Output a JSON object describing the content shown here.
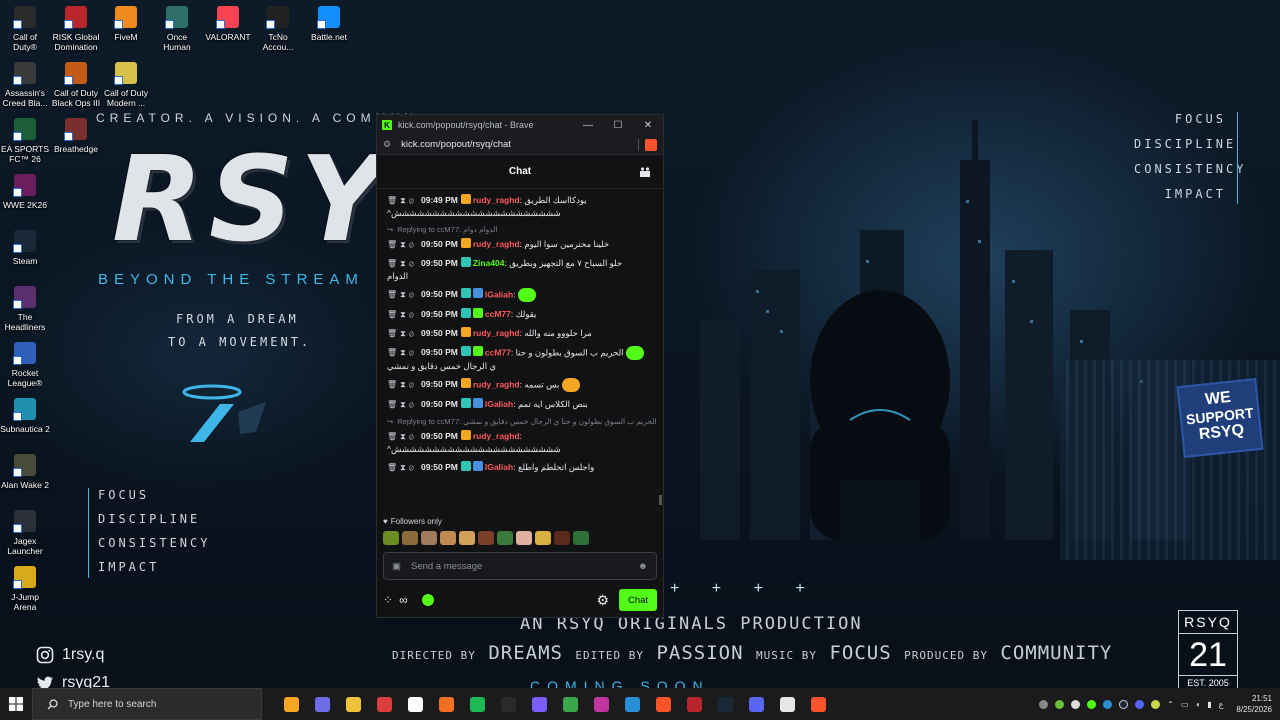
{
  "wallpaper": {
    "tagline": "CREATOR. A VISION. A COMMUN",
    "name": "RSYQ",
    "subtitle": "BEYOND THE STREAM",
    "dream_line1": "FROM A DREAM",
    "dream_line2": "TO A MOVEMENT.",
    "values": [
      "FOCUS",
      "DISCIPLINE",
      "CONSISTENCY",
      "IMPACT"
    ],
    "support_sign": [
      "WE",
      "SUPPORT",
      "RSYQ"
    ],
    "pluses": "+ + + +",
    "production": "AN RSYQ ORIGINALS PRODUCTION",
    "credits": [
      {
        "label": "DIRECTED BY",
        "value": "DREAMS"
      },
      {
        "label": "EDITED BY",
        "value": "PASSION"
      },
      {
        "label": "MUSIC BY",
        "value": "FOCUS"
      },
      {
        "label": "PRODUCED BY",
        "value": "COMMUNITY"
      }
    ],
    "coming_soon": "COMING SOON",
    "badge": {
      "top": "RSYQ",
      "number": "21",
      "est": "EST. 2005"
    },
    "instagram": "1rsy.q",
    "twitter": "rsyq21",
    "accent_color": "#3fb6e8"
  },
  "desktop_icons": [
    {
      "label": "Call of Duty®",
      "color": "#2b2b2b"
    },
    {
      "label": "RISK Global Domination",
      "color": "#b8262c"
    },
    {
      "label": "FiveM",
      "color": "#f08a1c"
    },
    {
      "label": "Once Human",
      "color": "#2f6f6a"
    },
    {
      "label": "VALORANT",
      "color": "#fa4454"
    },
    {
      "label": "TcNo Accou...",
      "color": "#222222"
    },
    {
      "label": "Battle.net",
      "color": "#148eff"
    },
    {
      "label": "Assassin's Creed Bla...",
      "color": "#3a3a3a"
    },
    {
      "label": "Call of Duty Black Ops III",
      "color": "#c25a18"
    },
    {
      "label": "Call of Duty Modern ...",
      "color": "#d8c14a"
    },
    {
      "label": "EA SPORTS FC™ 26",
      "color": "#1d5e3a"
    },
    {
      "label": "Breathedge",
      "color": "#7a2f2f"
    },
    {
      "label": "WWE 2K26",
      "color": "#6b1e5e"
    },
    {
      "label": "Steam",
      "color": "#1b2838"
    },
    {
      "label": "The Headliners",
      "color": "#5a2f6e"
    },
    {
      "label": "Rocket League®",
      "color": "#2f5fb8"
    },
    {
      "label": "Subnautica 2",
      "color": "#1f8fb0"
    },
    {
      "label": "Alan Wake 2",
      "color": "#4a4a3a"
    },
    {
      "label": "Jagex Launcher",
      "color": "#2a2f3a"
    },
    {
      "label": "J-Jump Arena",
      "color": "#d8a91a"
    }
  ],
  "browser": {
    "window_title": "kick.com/popout/rsyq/chat - Brave",
    "url": "kick.com/popout/rsyq/chat",
    "minimize": "—",
    "maximize": "☐",
    "close": "✕"
  },
  "chat": {
    "header": "Chat",
    "messages": [
      {
        "reply": "",
        "time": "09:49 PM",
        "badges": [
          "#f5a623"
        ],
        "user": "rudy_raghd",
        "user_color": "#ff5a5a",
        "text": "يودكااسك الطريق",
        "cont": "^شششششششششششششششششششششش",
        "emote": ""
      },
      {
        "reply": "Replying to ccM77: الدوام دوام",
        "time": "09:50 PM",
        "badges": [
          "#f5a623"
        ],
        "user": "rudy_raghd",
        "user_color": "#ff5a5a",
        "text": "خلينا محترمين سوا اليوم",
        "cont": "",
        "emote": ""
      },
      {
        "reply": "",
        "time": "09:50 PM",
        "badges": [
          "#2ec4b6"
        ],
        "user": "Zina404",
        "user_color": "#53fc18",
        "text": "حلو السباح ٧ مع التجهيز وبطريق",
        "cont": "الدوام",
        "emote": ""
      },
      {
        "reply": "",
        "time": "09:50 PM",
        "badges": [
          "#2ec4b6",
          "#4a90e2"
        ],
        "user": "lGaliah",
        "user_color": "#ff5a5a",
        "text": "",
        "cont": "",
        "emote": "#53fc18"
      },
      {
        "reply": "",
        "time": "09:50 PM",
        "badges": [
          "#2ec4b6",
          "#53fc18"
        ],
        "user": "ccM77",
        "user_color": "#ff5a5a",
        "text": "يقولك",
        "cont": "",
        "emote": ""
      },
      {
        "reply": "",
        "time": "09:50 PM",
        "badges": [
          "#f5a623"
        ],
        "user": "rudy_raghd",
        "user_color": "#ff5a5a",
        "text": "مرا حلووو منه والله",
        "cont": "",
        "emote": ""
      },
      {
        "reply": "",
        "time": "09:50 PM",
        "badges": [
          "#2ec4b6",
          "#53fc18"
        ],
        "user": "ccM77",
        "user_color": "#ff5a5a",
        "text": "الحريم ب السوق بطولون و حنا",
        "cont": "ي الرجال خمس دقايق و نمشي",
        "emote": "#53fc18"
      },
      {
        "reply": "",
        "time": "09:50 PM",
        "badges": [
          "#f5a623"
        ],
        "user": "rudy_raghd",
        "user_color": "#ff5a5a",
        "text": "بس تسمه",
        "cont": "",
        "emote": "#f5a623"
      },
      {
        "reply": "",
        "time": "09:50 PM",
        "badges": [
          "#2ec4b6",
          "#4a90e2"
        ],
        "user": "lGaliah",
        "user_color": "#ff5a5a",
        "text": "بنص الكلاس ايه تمم",
        "cont": "",
        "emote": ""
      },
      {
        "reply": "Replying to ccM77: الحريم ب السوق بطولون و حنا ي الرجال خمس دقايق و نمشي",
        "time": "09:50 PM",
        "badges": [
          "#f5a623"
        ],
        "user": "rudy_raghd",
        "user_color": "#ff5a5a",
        "text": "",
        "cont": "^شششششششششششششششششششششش",
        "emote": ""
      },
      {
        "reply": "",
        "time": "09:50 PM",
        "badges": [
          "#2ec4b6",
          "#4a90e2"
        ],
        "user": "lGaliah",
        "user_color": "#ff5a5a",
        "text": "واجلس اتحلطم واطلع",
        "cont": "",
        "emote": ""
      }
    ],
    "followers_only": "Followers only",
    "emote_bar": [
      "#6b8e23",
      "#8b6b3a",
      "#a07a5a",
      "#c0894f",
      "#d2a25a",
      "#7b3f2a",
      "#3a7a3a",
      "#e0b0a0",
      "#d8b040",
      "#5a2a1a",
      "#2f6f3a"
    ],
    "send_placeholder": "Send a message",
    "infinity": "∞",
    "chat_button": "Chat",
    "brand_color": "#53fc18"
  },
  "taskbar": {
    "search_placeholder": "Type here to search",
    "apps": [
      "#f5a623",
      "#6e6ee6",
      "#f0c23a",
      "#dc3e3e",
      "#ffffff",
      "#f36f21",
      "#1db954",
      "#2a2a2a",
      "#7a5cff",
      "#3aa84a",
      "#c0369e",
      "#2a8fd6",
      "#fb542b",
      "#b8262c",
      "#1b2838",
      "#5865f2",
      "#e6e6e6",
      "#fb542b"
    ],
    "time": "21:51",
    "date": "8/25/2026",
    "lang": "ع"
  }
}
